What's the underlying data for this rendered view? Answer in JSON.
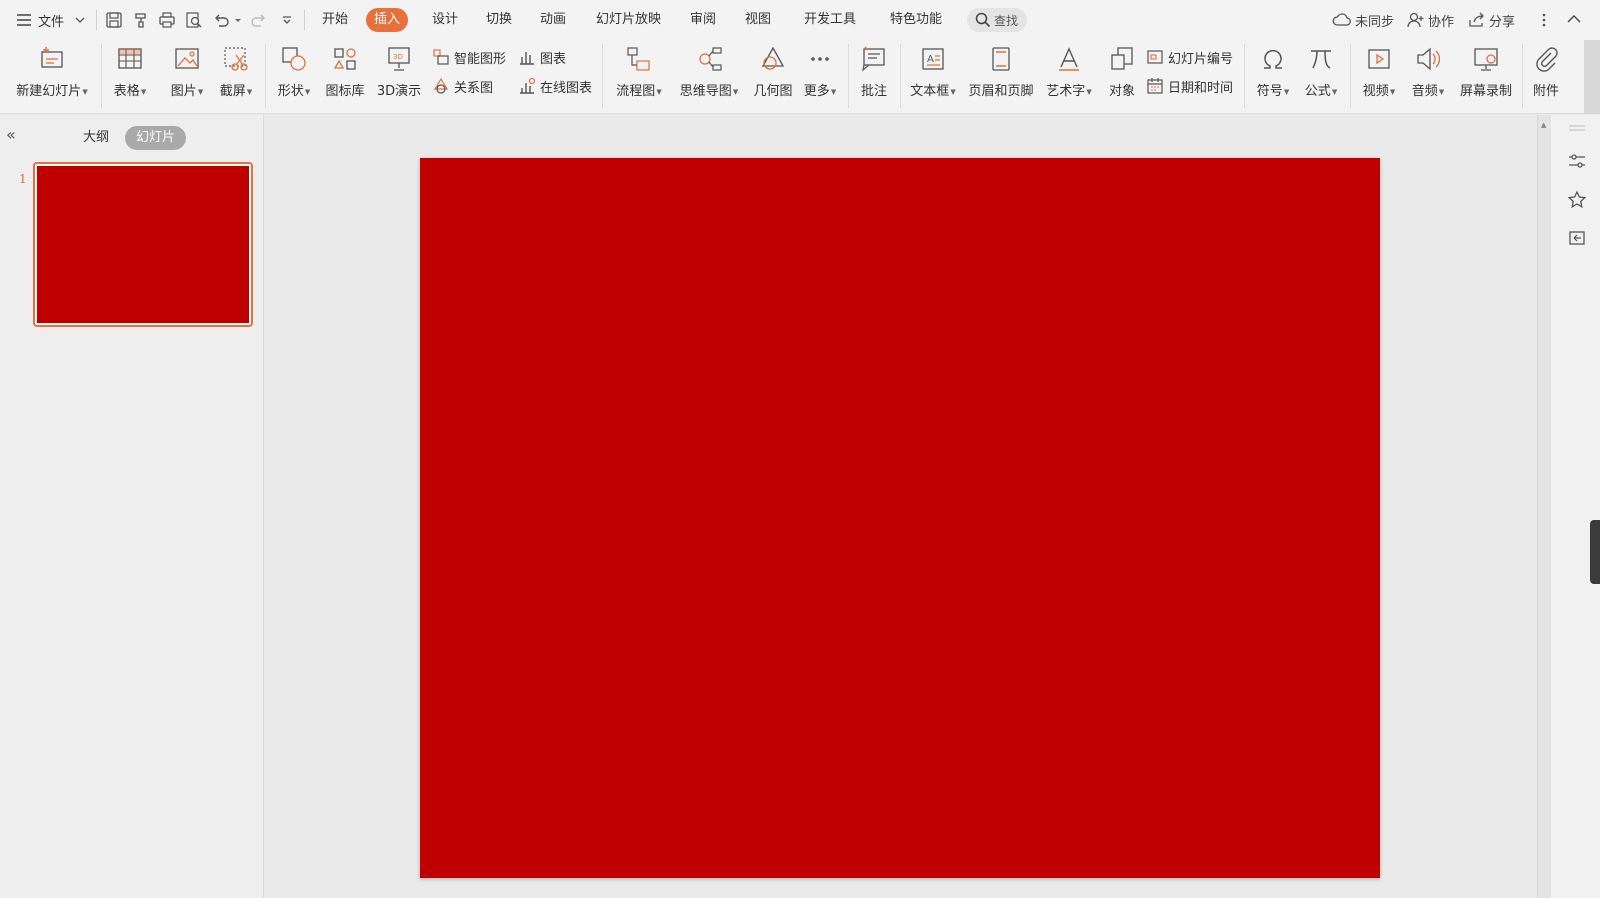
{
  "menu": {
    "file_label": "文件",
    "tabs": [
      {
        "label": "开始",
        "active": false
      },
      {
        "label": "插入",
        "active": true
      },
      {
        "label": "设计",
        "active": false
      },
      {
        "label": "切换",
        "active": false
      },
      {
        "label": "动画",
        "active": false
      },
      {
        "label": "幻灯片放映",
        "active": false
      },
      {
        "label": "审阅",
        "active": false
      },
      {
        "label": "视图",
        "active": false
      },
      {
        "label": "开发工具",
        "active": false
      },
      {
        "label": "特色功能",
        "active": false
      }
    ],
    "search_label": "查找",
    "sync_label": "未同步",
    "collab_label": "协作",
    "share_label": "分享"
  },
  "ribbon": {
    "new_slide": "新建幻灯片",
    "table": "表格",
    "picture": "图片",
    "screenshot": "截屏",
    "shape": "形状",
    "icon_lib": "图标库",
    "demo_3d": "3D演示",
    "smart_art": "智能图形",
    "chart": "图表",
    "relation": "关系图",
    "online_chart": "在线图表",
    "flowchart": "流程图",
    "mindmap": "思维导图",
    "geometry": "几何图",
    "more": "更多",
    "comment": "批注",
    "textbox": "文本框",
    "header_footer": "页眉和页脚",
    "wordart": "艺术字",
    "object": "对象",
    "slide_number": "幻灯片编号",
    "datetime": "日期和时间",
    "symbol": "符号",
    "formula": "公式",
    "video": "视频",
    "audio": "音频",
    "screen_record": "屏幕录制",
    "attachment": "附件"
  },
  "left_panel": {
    "outline_label": "大纲",
    "slides_label": "幻灯片",
    "slides": [
      {
        "number": "1"
      }
    ]
  },
  "colors": {
    "accent": "#e8703a",
    "slide_background": "#c00000"
  }
}
